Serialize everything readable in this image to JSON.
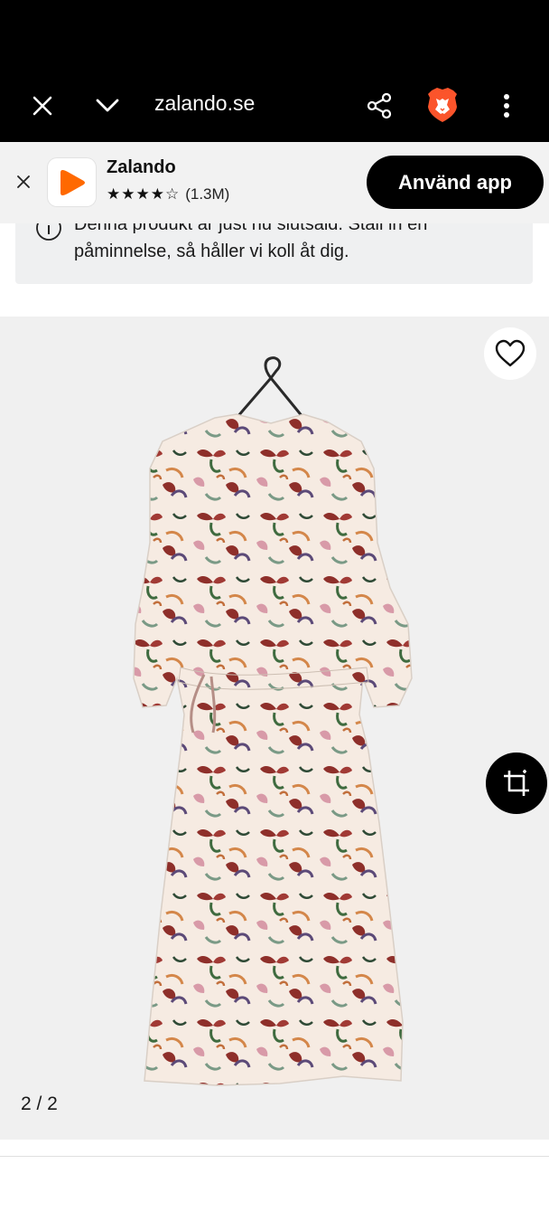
{
  "browser": {
    "url": "zalando.se"
  },
  "app_banner": {
    "app_name": "Zalando",
    "stars": "★★★★☆",
    "rating_count": "(1.3M)",
    "cta_label": "Använd app"
  },
  "notice": {
    "text_line1": "Denna produkt är just nu slutsåld. Ställ in en",
    "text_line2": "påminnelse, så håller vi koll åt dig."
  },
  "gallery": {
    "counter": "2 / 2"
  },
  "colors": {
    "brand_orange": "#ff6900",
    "brave_orange": "#fb542b",
    "dark": "#000000"
  }
}
